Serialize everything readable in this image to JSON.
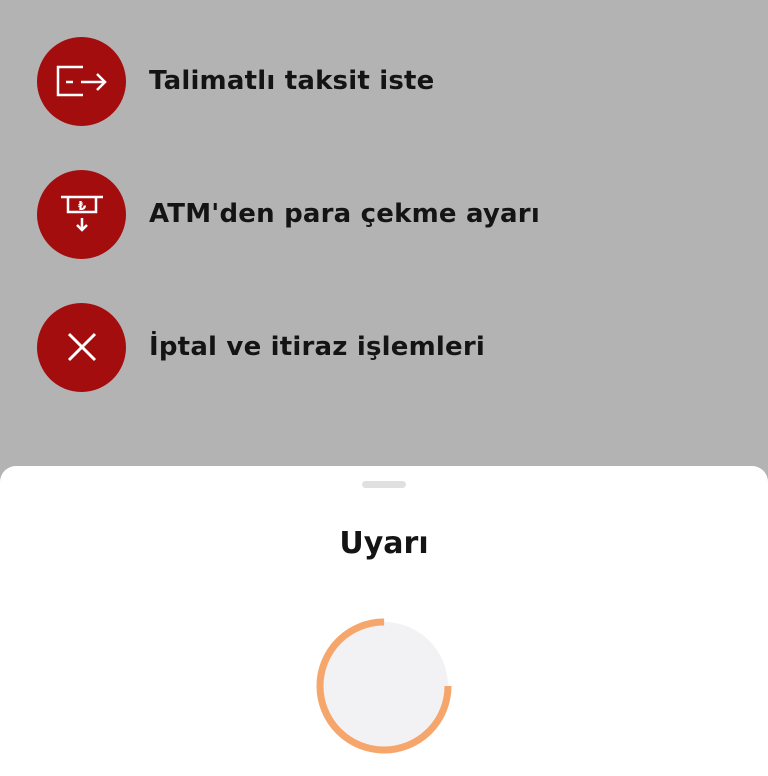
{
  "menu": {
    "items": [
      {
        "label": "Talimatlı taksit iste",
        "icon": "card-arrow-icon"
      },
      {
        "label": "ATM'den para çekme ayarı",
        "icon": "atm-withdraw-icon"
      },
      {
        "label": "İptal ve itiraz işlemleri",
        "icon": "close-x-icon"
      }
    ]
  },
  "sheet": {
    "title": "Uyarı",
    "timer": {
      "progress": 0.75
    }
  },
  "colors": {
    "overlay_background": "#b3b3b3",
    "icon_circle": "#a30d0d",
    "sheet_background": "#ffffff",
    "timer_arc": "#f6a56b",
    "timer_track": "#f2f2f4"
  }
}
